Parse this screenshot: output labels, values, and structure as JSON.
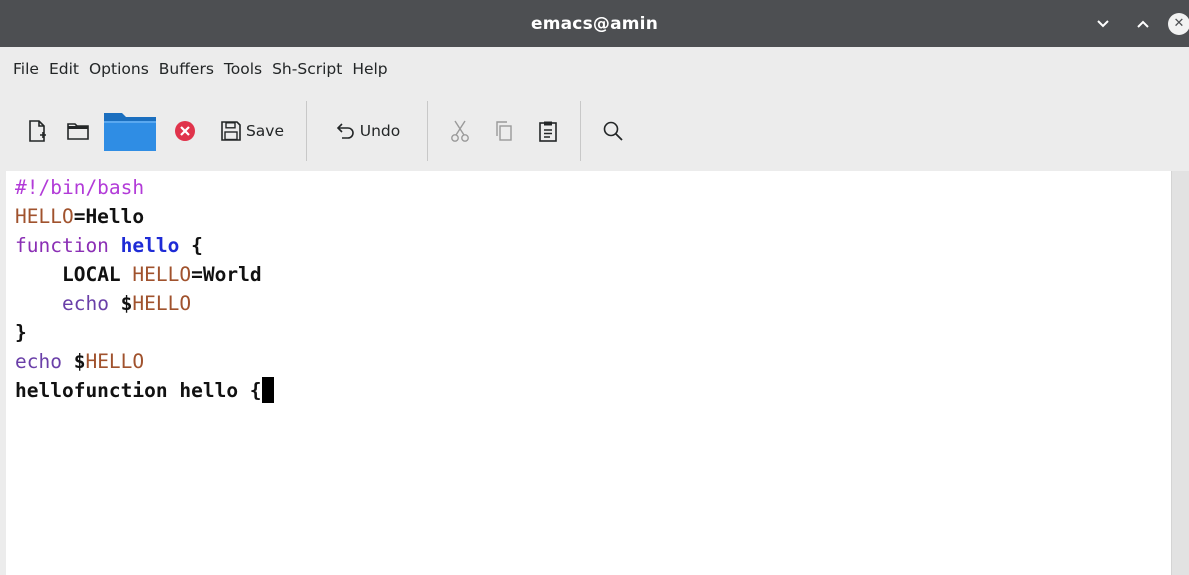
{
  "window": {
    "title": "emacs@amin"
  },
  "menu": [
    "File",
    "Edit",
    "Options",
    "Buffers",
    "Tools",
    "Sh-Script",
    "Help"
  ],
  "toolbar": {
    "save_label": "Save",
    "undo_label": "Undo"
  },
  "editor": {
    "line1": {
      "shebang": "#!/bin/bash"
    },
    "line2": {
      "var": "HELLO",
      "eq": "=Hello"
    },
    "line3": {
      "kw": "function",
      "name": "hello",
      "brace": " {"
    },
    "line4": {
      "indent": "    ",
      "local": "LOCAL ",
      "var": "HELLO",
      "eq": "=World"
    },
    "line5": {
      "indent": "    ",
      "echo": "echo ",
      "dollar": "$",
      "var": "HELLO"
    },
    "line6": {
      "brace": "}"
    },
    "line7": {
      "echo": "echo ",
      "dollar": "$",
      "var": "HELLO"
    },
    "line8": {
      "text": "hellofunction hello {"
    }
  },
  "colors": {
    "titlebar": "#4d4f52",
    "shebang": "#b23bd8",
    "variable": "#a0522d",
    "function_name": "#1e2bd6"
  }
}
